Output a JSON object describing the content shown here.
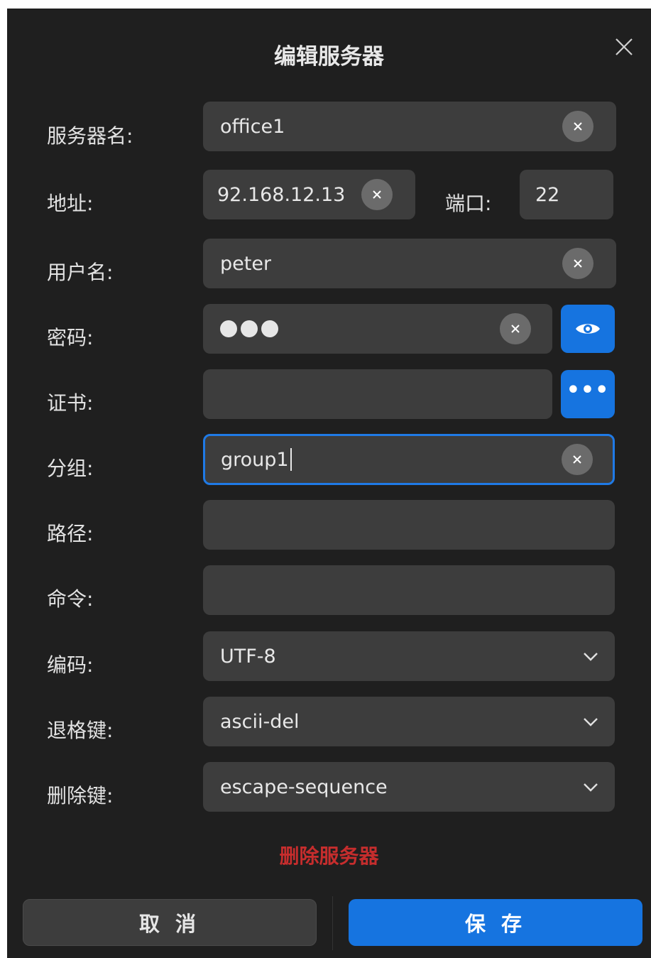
{
  "dialog": {
    "title": "编辑服务器"
  },
  "form": {
    "name": {
      "label": "服务器名:",
      "value": "office1"
    },
    "address": {
      "label": "地址:",
      "value": "92.168.12.13"
    },
    "port": {
      "label": "端口:",
      "value": "22"
    },
    "username": {
      "label": "用户名:",
      "value": "peter"
    },
    "password": {
      "label": "密码:",
      "masked_length": 3
    },
    "certificate": {
      "label": "证书:",
      "value": "",
      "browse_label": "•••"
    },
    "group": {
      "label": "分组:",
      "value": "group1"
    },
    "path": {
      "label": "路径:",
      "value": ""
    },
    "command": {
      "label": "命令:",
      "value": ""
    },
    "encoding": {
      "label": "编码:",
      "value": "UTF-8"
    },
    "backspace": {
      "label": "退格键:",
      "value": "ascii-del"
    },
    "delete": {
      "label": "删除键:",
      "value": "escape-sequence"
    }
  },
  "actions": {
    "delete_server": "删除服务器",
    "cancel": "取 消",
    "save": "保 存"
  },
  "colors": {
    "accent": "#1674e0",
    "danger": "#c62d2d",
    "background": "#1f1f1f",
    "field": "#3d3d3d"
  },
  "icons": {
    "close": "close-icon",
    "clear": "clear-icon",
    "eye": "eye-icon",
    "more": "more-icon",
    "dropdown": "chevron-down-icon"
  }
}
